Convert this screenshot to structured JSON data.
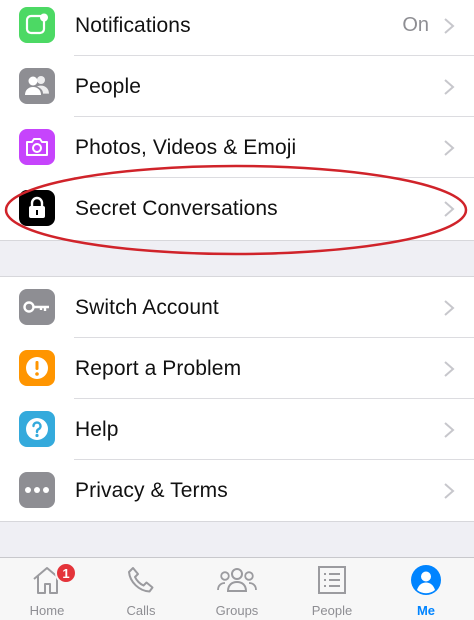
{
  "settings_group_1": [
    {
      "label": "Notifications",
      "value": "On",
      "icon": "notifications-icon",
      "color": "#4cd964"
    },
    {
      "label": "People",
      "value": "",
      "icon": "people-icon",
      "color": "#8e8e93"
    },
    {
      "label": "Photos, Videos & Emoji",
      "value": "",
      "icon": "camera-icon",
      "color": "#c644fc"
    },
    {
      "label": "Secret Conversations",
      "value": "",
      "icon": "lock-icon",
      "color": "#000000"
    }
  ],
  "settings_group_2": [
    {
      "label": "Switch Account",
      "icon": "key-icon",
      "color": "#8e8e93"
    },
    {
      "label": "Report a Problem",
      "icon": "exclamation-icon",
      "color": "#ff9500"
    },
    {
      "label": "Help",
      "icon": "question-icon",
      "color": "#34aadc"
    },
    {
      "label": "Privacy & Terms",
      "icon": "ellipsis-icon",
      "color": "#8e8e93"
    }
  ],
  "highlight": {
    "color": "#d0232a"
  },
  "tabbar": {
    "tabs": [
      {
        "label": "Home",
        "icon": "home-icon",
        "badge": "1"
      },
      {
        "label": "Calls",
        "icon": "phone-icon"
      },
      {
        "label": "Groups",
        "icon": "groups-icon"
      },
      {
        "label": "People",
        "icon": "contacts-list-icon"
      },
      {
        "label": "Me",
        "icon": "profile-icon",
        "active": true
      }
    ],
    "active_color": "#0084ff",
    "badge_color": "#e4343a"
  }
}
